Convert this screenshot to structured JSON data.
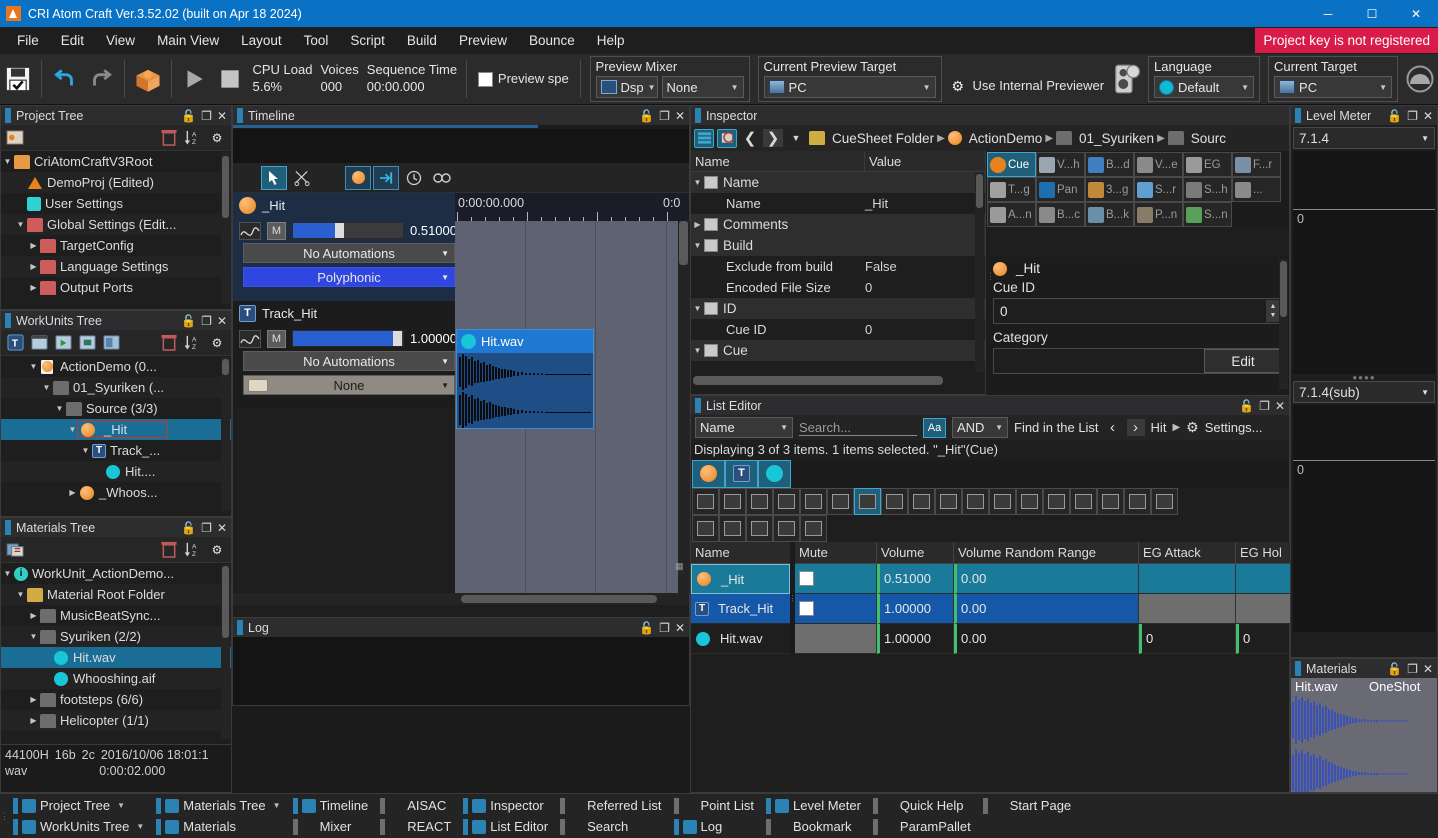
{
  "window": {
    "title": "CRI Atom Craft Ver.3.52.02 (built on Apr 18 2024)",
    "minimize": "─",
    "maximize": "☐",
    "close": "✕"
  },
  "menu": {
    "items": [
      "File",
      "Edit",
      "View",
      "Main View",
      "Layout",
      "Tool",
      "Script",
      "Build",
      "Preview",
      "Bounce",
      "Help"
    ],
    "project_key_warning": "Project key is not registered"
  },
  "toolbar": {
    "save_icon": "save-icon",
    "undo_icon": "undo-icon",
    "redo_icon": "redo-icon",
    "build_icon": "build-package-icon",
    "play_icon": "play-icon",
    "stop_icon": "stop-icon",
    "cpu_label": "CPU Load",
    "cpu_value": "5.6%",
    "voices_label": "Voices",
    "voices_value": "000",
    "seqtime_label": "Sequence Time",
    "seqtime_value": "00:00.000",
    "preview_speed_label": "Preview spe",
    "preview_mixer_label": "Preview Mixer",
    "preview_mixer_dsp": "Dsp",
    "preview_mixer_none": "None",
    "current_preview_target_label": "Current Preview Target",
    "current_preview_target_value": "PC",
    "use_internal_previewer": "Use Internal Previewer",
    "language_label": "Language",
    "language_value": "Default",
    "current_target_label": "Current Target",
    "current_target_value": "PC"
  },
  "project_tree": {
    "title": "Project Tree",
    "rows": [
      {
        "indent": 0,
        "arrow": "▼",
        "icon": "folder-orange",
        "label": "CriAtomCraftV3Root"
      },
      {
        "indent": 1,
        "arrow": "",
        "icon": "triangle-orange",
        "label": "DemoProj (Edited)"
      },
      {
        "indent": 1,
        "arrow": "",
        "icon": "user-settings",
        "label": "User Settings"
      },
      {
        "indent": 1,
        "arrow": "▼",
        "icon": "folder-red",
        "label": "Global Settings (Edit..."
      },
      {
        "indent": 2,
        "arrow": "▶",
        "icon": "folder-red",
        "label": "TargetConfig"
      },
      {
        "indent": 2,
        "arrow": "▶",
        "icon": "folder-red",
        "label": "Language Settings"
      },
      {
        "indent": 2,
        "arrow": "▶",
        "icon": "folder-red",
        "label": "Output Ports"
      }
    ]
  },
  "workunits_tree": {
    "title": "WorkUnits Tree",
    "rows": [
      {
        "indent": 2,
        "arrow": "▼",
        "icon": "doc-orange",
        "label": "ActionDemo (0...",
        "sel": false
      },
      {
        "indent": 3,
        "arrow": "▼",
        "icon": "folder-grey",
        "label": "01_Syuriken (...",
        "sel": false
      },
      {
        "indent": 4,
        "arrow": "▼",
        "icon": "folder-grey",
        "label": "Source (3/3)",
        "sel": false
      },
      {
        "indent": 5,
        "arrow": "▼",
        "icon": "cue",
        "label": "_Hit",
        "sel": true
      },
      {
        "indent": 6,
        "arrow": "▼",
        "icon": "track",
        "label": "Track_...",
        "sel": false
      },
      {
        "indent": 7,
        "arrow": "",
        "icon": "wave",
        "label": "Hit....",
        "sel": false
      },
      {
        "indent": 5,
        "arrow": "▶",
        "icon": "cue",
        "label": "_Whoos...",
        "sel": false
      }
    ]
  },
  "materials_tree": {
    "title": "Materials Tree",
    "rows": [
      {
        "indent": 0,
        "arrow": "▼",
        "icon": "info",
        "label": "WorkUnit_ActionDemo...",
        "sel": false
      },
      {
        "indent": 1,
        "arrow": "▼",
        "icon": "folder-yellow",
        "label": "Material Root Folder",
        "sel": false
      },
      {
        "indent": 2,
        "arrow": "▶",
        "icon": "folder-grey",
        "label": "MusicBeatSync...",
        "sel": false
      },
      {
        "indent": 2,
        "arrow": "▼",
        "icon": "folder-grey",
        "label": "Syuriken (2/2)",
        "sel": false
      },
      {
        "indent": 3,
        "arrow": "",
        "icon": "wave-file",
        "label": "Hit.wav",
        "sel": true
      },
      {
        "indent": 3,
        "arrow": "",
        "icon": "wave-file",
        "label": "Whooshing.aif",
        "sel": false
      },
      {
        "indent": 2,
        "arrow": "▶",
        "icon": "folder-grey",
        "label": "footsteps (6/6)",
        "sel": false
      },
      {
        "indent": 2,
        "arrow": "▶",
        "icon": "folder-grey",
        "label": "Helicopter (1/1)",
        "sel": false
      }
    ],
    "info_line1": [
      "44100H",
      "16b",
      "2c",
      "2016/10/06 18:01:1"
    ],
    "info_line2": [
      "wav",
      "0:00:02.000"
    ]
  },
  "timeline": {
    "title": "Timeline",
    "tools": {
      "select": "cursor-arrow-icon",
      "scissors": "scissors-icon",
      "cue_marker": "cue-ball-icon",
      "snap": "snap-arrow-icon",
      "clock": "clock-icon",
      "link": "link-icon"
    },
    "ruler_labels": [
      "0:00:00.000",
      "0:0"
    ],
    "cue_track": {
      "name": "_Hit",
      "volume": "0.51000",
      "automations": "No Automations",
      "type": "Polyphonic",
      "mute": "M"
    },
    "track": {
      "name": "Track_Hit",
      "volume": "1.00000",
      "automations": "No Automations",
      "aisac": "None",
      "mute": "M"
    },
    "clip": {
      "label": "Hit.wav"
    }
  },
  "inspector": {
    "title": "Inspector",
    "breadcrumb": [
      "CueSheet Folder",
      "ActionDemo",
      "01_Syuriken",
      "Sourc"
    ],
    "col_name": "Name",
    "col_value": "Value",
    "rows": [
      {
        "group": true,
        "arrow": "▼",
        "label": "Name",
        "value": ""
      },
      {
        "group": false,
        "arrow": "",
        "label": "Name",
        "value": "_Hit"
      },
      {
        "group": true,
        "arrow": "▶",
        "label": "Comments",
        "value": ""
      },
      {
        "group": true,
        "arrow": "▼",
        "label": "Build",
        "value": ""
      },
      {
        "group": false,
        "arrow": "",
        "label": "Exclude from build",
        "value": "False"
      },
      {
        "group": false,
        "arrow": "",
        "label": "Encoded File Size",
        "value": "0"
      },
      {
        "group": true,
        "arrow": "▼",
        "label": "ID",
        "value": ""
      },
      {
        "group": false,
        "arrow": "",
        "label": "Cue ID",
        "value": "0"
      },
      {
        "group": true,
        "arrow": "▼",
        "label": "Cue",
        "value": ""
      }
    ],
    "param_buttons": [
      {
        "label": "Cue",
        "on": true
      },
      {
        "label": "V...h",
        "on": false
      },
      {
        "label": "B...d",
        "on": false
      },
      {
        "label": "V...e",
        "on": false
      },
      {
        "label": "EG",
        "on": false
      },
      {
        "label": "F...r",
        "on": false
      },
      {
        "label": "T...g",
        "on": false
      },
      {
        "label": "Pan",
        "on": false
      },
      {
        "label": "3...g",
        "on": false
      },
      {
        "label": "S...r",
        "on": false
      },
      {
        "label": "S...h",
        "on": false
      },
      {
        "label": "...",
        "on": false
      },
      {
        "label": "A...n",
        "on": false
      },
      {
        "label": "B...c",
        "on": false
      },
      {
        "label": "B...k",
        "on": false
      },
      {
        "label": "P...n",
        "on": false
      },
      {
        "label": "S...n",
        "on": false
      }
    ],
    "cue_panel": {
      "title": "_Hit",
      "cue_id_label": "Cue ID",
      "cue_id_value": "0",
      "category_label": "Category",
      "edit_button": "Edit"
    }
  },
  "list_editor": {
    "title": "List Editor",
    "filter_field": "Name",
    "search_placeholder": "Search...",
    "match_case": "Aa",
    "logic": "AND",
    "find_label": "Find in the List",
    "prev": "‹",
    "next": "›",
    "found_term": "Hit",
    "settings": "Settings...",
    "status": "Displaying 3 of 3 items. 1 items selected. \"_Hit\"(Cue)",
    "type_tabs": [
      {
        "name": "cue-type-tab",
        "on": true
      },
      {
        "name": "track-type-tab",
        "on": true
      },
      {
        "name": "waveform-type-tab",
        "on": true
      }
    ],
    "icon_row_1": [
      {
        "name": "comment-icon",
        "on": false
      },
      {
        "name": "import-icon",
        "on": false
      },
      {
        "name": "id-icon",
        "on": false
      },
      {
        "name": "record-icon",
        "on": false
      },
      {
        "name": "list-icon",
        "on": false
      },
      {
        "name": "curve-icon",
        "on": false
      },
      {
        "name": "volume-icon",
        "on": true
      },
      {
        "name": "pen-icon",
        "on": false
      },
      {
        "name": "range-icon",
        "on": false
      },
      {
        "name": "pan-icon",
        "on": false
      },
      {
        "name": "3d-icon",
        "on": false
      },
      {
        "name": "mixer-strip-icon",
        "on": false
      },
      {
        "name": "envelope-icon",
        "on": false
      },
      {
        "name": "bus-icon",
        "on": false
      },
      {
        "name": "mix-icon",
        "on": false
      },
      {
        "name": "block-icon",
        "on": false
      },
      {
        "name": "tool-icon",
        "on": false
      },
      {
        "name": "rows-icon",
        "on": false
      }
    ],
    "icon_row_2": [
      {
        "name": "loop-icon",
        "on": false
      },
      {
        "name": "disc-icon",
        "on": false
      },
      {
        "name": "samplerate-icon",
        "on": false
      },
      {
        "name": "note-icon",
        "on": false
      },
      {
        "name": "info-icon",
        "on": false
      }
    ],
    "columns": [
      "Name",
      "Mute",
      "Volume",
      "Volume Random Range",
      "EG Attack",
      "EG Hol"
    ],
    "rows": [
      {
        "icon": "cue",
        "name": "_Hit",
        "mute": true,
        "volume": "0.51000",
        "vrr": "0.00",
        "eg_attack": "",
        "eg_hold": "",
        "sel": "cy"
      },
      {
        "icon": "track",
        "name": "Track_Hit",
        "mute": true,
        "volume": "1.00000",
        "vrr": "0.00",
        "eg_attack": "",
        "eg_hold": "",
        "sel": "bl"
      },
      {
        "icon": "wave",
        "name": "Hit.wav",
        "mute": null,
        "volume": "1.00000",
        "vrr": "0.00",
        "eg_attack": "0",
        "eg_hold": "0",
        "sel": "none"
      }
    ]
  },
  "log": {
    "title": "Log"
  },
  "level_meter": {
    "title": "Level Meter",
    "main_select": "7.1.4",
    "main_zero": "0",
    "sub_select": "7.1.4(sub)",
    "sub_zero": "0"
  },
  "materials_panel": {
    "title": "Materials",
    "file_name": "Hit.wav",
    "play_type": "OneShot"
  },
  "taskbar": {
    "groups": [
      {
        "top": {
          "label": "Project Tree",
          "icon": "project-tree-icon",
          "accent": "#2b83b5",
          "caret": true
        },
        "bottom": {
          "label": "WorkUnits Tree",
          "icon": "workunits-tree-icon",
          "accent": "#2b83b5",
          "caret": true
        }
      },
      {
        "top": {
          "label": "Materials Tree",
          "icon": "materials-tree-icon",
          "accent": "#2b83b5",
          "caret": true
        },
        "bottom": {
          "label": "Materials",
          "icon": "materials-icon",
          "accent": "#2b83b5",
          "caret": false
        }
      },
      {
        "top": {
          "label": "Timeline",
          "icon": "timeline-icon",
          "accent": "#2b83b5",
          "caret": false
        },
        "bottom": {
          "label": "Mixer",
          "icon": "mixer-icon",
          "accent": "#6e6e6e",
          "caret": false
        }
      },
      {
        "top": {
          "label": "AISAC",
          "icon": "aisac-icon",
          "accent": "#6e6e6e",
          "caret": false
        },
        "bottom": {
          "label": "REACT",
          "icon": "react-icon",
          "accent": "#6e6e6e",
          "caret": false
        }
      },
      {
        "top": {
          "label": "Inspector",
          "icon": "inspector-icon",
          "accent": "#2b83b5",
          "caret": false
        },
        "bottom": {
          "label": "List Editor",
          "icon": "list-editor-icon",
          "accent": "#2b83b5",
          "caret": false
        }
      },
      {
        "top": {
          "label": "Referred List",
          "icon": "referred-list-icon",
          "accent": "#6e6e6e",
          "caret": false
        },
        "bottom": {
          "label": "Search",
          "icon": "search-icon",
          "accent": "#6e6e6e",
          "caret": false
        }
      },
      {
        "top": {
          "label": "Point List",
          "icon": "point-list-icon",
          "accent": "#6e6e6e",
          "caret": false
        },
        "bottom": {
          "label": "Log",
          "icon": "log-icon",
          "accent": "#2b83b5",
          "caret": false
        }
      },
      {
        "top": {
          "label": "Level Meter",
          "icon": "level-meter-icon",
          "accent": "#2b83b5",
          "caret": false
        },
        "bottom": {
          "label": "Bookmark",
          "icon": "bookmark-icon",
          "accent": "#6e6e6e",
          "caret": false
        }
      },
      {
        "top": {
          "label": "Quick Help",
          "icon": "quick-help-icon",
          "accent": "#6e6e6e",
          "caret": false
        },
        "bottom": {
          "label": "ParamPallet",
          "icon": "parampallet-icon",
          "accent": "#6e6e6e",
          "caret": false
        }
      },
      {
        "top": {
          "label": "Start Page",
          "icon": "start-page-icon",
          "accent": "#6e6e6e",
          "caret": false
        },
        "bottom": {
          "label": "",
          "icon": "",
          "accent": "",
          "caret": false
        }
      }
    ]
  }
}
